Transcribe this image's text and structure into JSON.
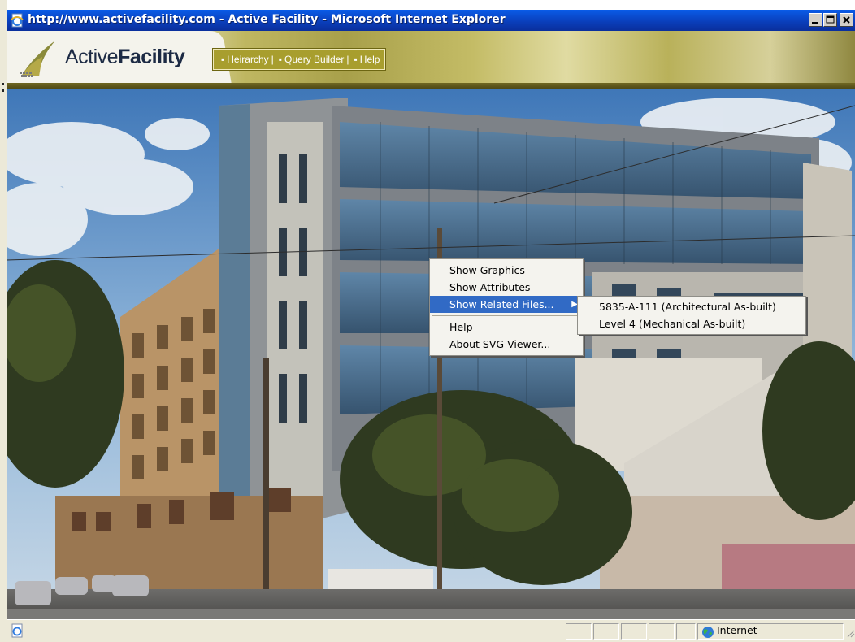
{
  "window": {
    "title": "http://www.activefacility.com - Active Facility - Microsoft Internet Explorer",
    "icon": "ie-page-icon",
    "controls": [
      "minimize-icon",
      "maximize-icon",
      "close-icon"
    ]
  },
  "header": {
    "logo_text_regular": "Active",
    "logo_text_bold": "Facility",
    "nav": [
      {
        "label": "Heirarchy"
      },
      {
        "label": "Query Builder"
      },
      {
        "label": "Help"
      }
    ]
  },
  "context_menu": {
    "items": [
      {
        "label": "Show Graphics"
      },
      {
        "label": "Show Attributes"
      },
      {
        "label": "Show Related Files...",
        "highlighted": true,
        "has_submenu": true
      },
      {
        "label": "Help"
      },
      {
        "label": "About SVG Viewer..."
      }
    ]
  },
  "submenu": {
    "items": [
      {
        "label": "5835-A-111 (Architectural As-built)"
      },
      {
        "label": "Level 4 (Mechanical As-built)"
      }
    ]
  },
  "status_bar": {
    "zone": "Internet",
    "zone_icon": "globe-icon",
    "left_icon": "page-icon"
  },
  "colors": {
    "titlebar": "#0a3db8",
    "menu_highlight": "#316ac5",
    "nav_bg": "#a89e2e"
  }
}
